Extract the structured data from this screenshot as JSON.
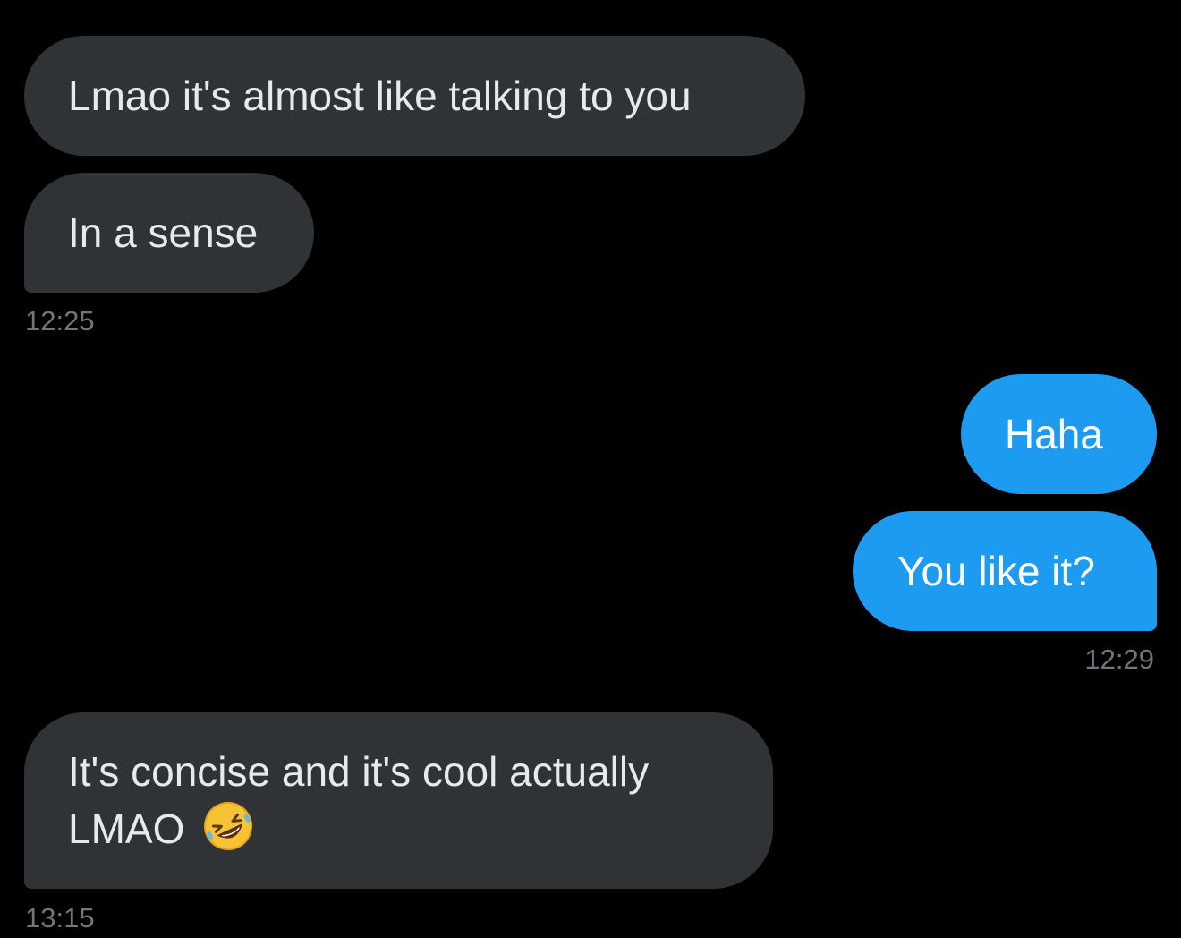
{
  "conversation": {
    "messages": [
      {
        "direction": "incoming",
        "text": "Lmao it's almost like talking to you"
      },
      {
        "direction": "incoming",
        "text": "In a sense"
      },
      {
        "direction": "outgoing",
        "text": "Haha"
      },
      {
        "direction": "outgoing",
        "text": "You like it?"
      },
      {
        "direction": "incoming",
        "text_line1": "It's concise and it's cool actually",
        "text_line2": "LMAO",
        "emoji": "rolling-on-floor-laughing-emoji"
      }
    ],
    "timestamps": [
      "12:25",
      "12:29",
      "13:15"
    ]
  },
  "colors": {
    "background": "#000000",
    "incoming_bubble": "#2f3336",
    "outgoing_bubble": "#1d9bf0",
    "timestamp_text": "#71767b"
  }
}
